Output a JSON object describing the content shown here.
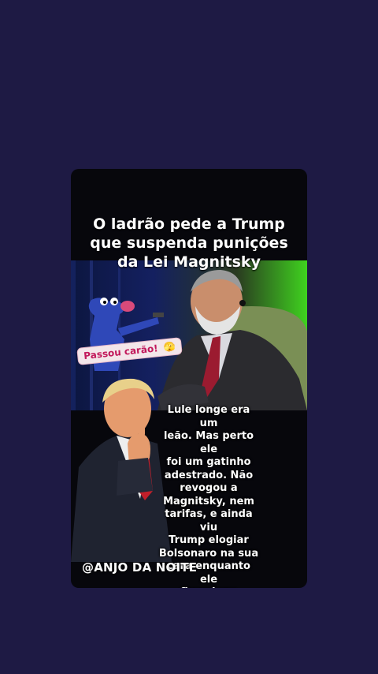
{
  "post": {
    "headline": "O ladrão pede a Trump\nque suspenda punições\nda Lei Magnitsky",
    "sticker_text": "Passou carão!",
    "sticker_emoji": "🫣",
    "caption": "Lule longe era um\nleão. Mas perto ele\nfoi um gatinho\nadestrado. Não\nrevogou a\nMagnitsky, nem\ntarifas, e ainda viu\nTrump elogiar\nBolsonaro na sua\ncara enquanto ele\nficou bem\nquietinho.",
    "watermark": "@ANJO DA NOITE"
  },
  "colors": {
    "background": "#1e1a44",
    "card": "#07070c",
    "sticker_text": "#c2185b",
    "green_screen": "#3fd21f"
  }
}
